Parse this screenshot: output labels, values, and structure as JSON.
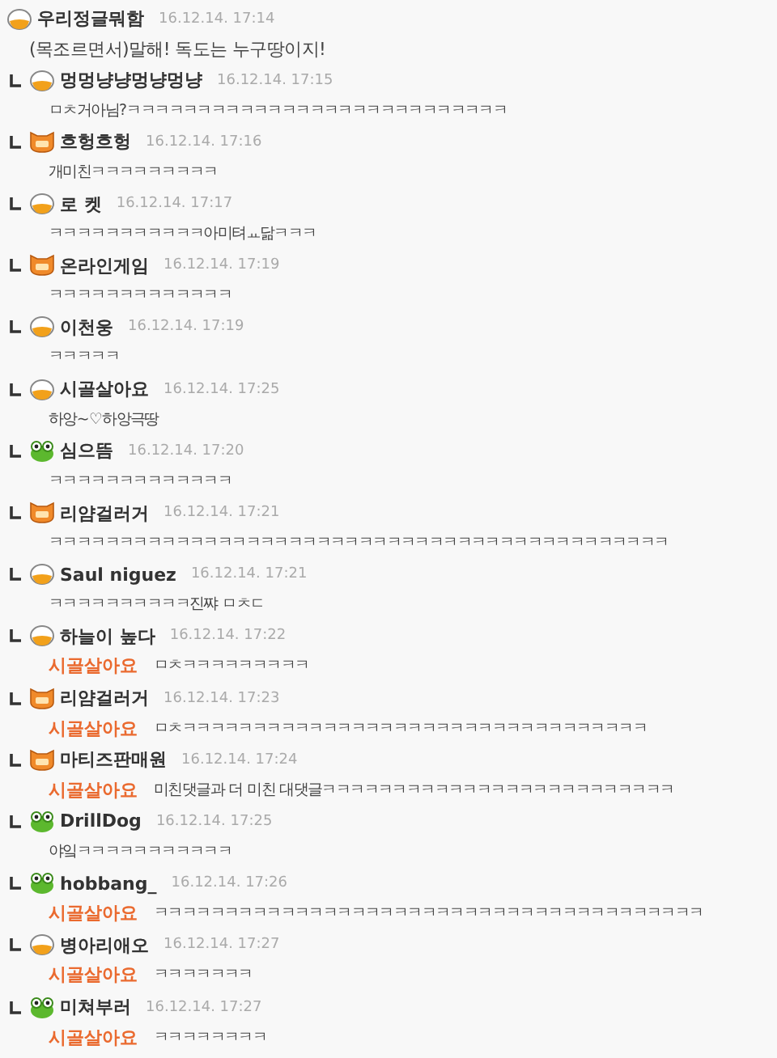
{
  "comments": [
    {
      "reply": false,
      "kind": "pot",
      "name": "우리정글뭐함",
      "time": "16.12.14. 17:14",
      "text": "(목조르면서)말해! 독도는 누구땅이지!"
    },
    {
      "reply": true,
      "kind": "pot",
      "name": "멍멍냥냥멍냥멍냥",
      "time": "16.12.14. 17:15",
      "text": "ㅁㅊ거아님?ㅋㅋㅋㅋㅋㅋㅋㅋㅋㅋㅋㅋㅋㅋㅋㅋㅋㅋㅋㅋㅋㅋㅋㅋㅋㅋㅋ"
    },
    {
      "reply": true,
      "kind": "cat",
      "name": "흐헝흐헝",
      "time": "16.12.14. 17:16",
      "text": "개미친ㅋㅋㅋㅋㅋㅋㅋㅋㅋ"
    },
    {
      "reply": true,
      "kind": "pot",
      "name": "로 켓",
      "time": "16.12.14. 17:17",
      "text": "ㅋㅋㅋㅋㅋㅋㅋㅋㅋㅋㅋ아미텨ㅛ닮ㅋㅋㅋ"
    },
    {
      "reply": true,
      "kind": "cat",
      "name": "온라인게임",
      "time": "16.12.14. 17:19",
      "text": "ㅋㅋㅋㅋㅋㅋㅋㅋㅋㅋㅋㅋㅋ"
    },
    {
      "reply": true,
      "kind": "pot",
      "name": "이천웅",
      "time": "16.12.14. 17:19",
      "text": "ㅋㅋㅋㅋㅋ"
    },
    {
      "reply": true,
      "kind": "pot",
      "name": "시골살아요",
      "time": "16.12.14. 17:25",
      "text": "하앙~♡하앙극땅"
    },
    {
      "reply": true,
      "kind": "frog",
      "name": "심으뜸",
      "time": "16.12.14. 17:20",
      "text": "ㅋㅋㅋㅋㅋㅋㅋㅋㅋㅋㅋㅋㅋ"
    },
    {
      "reply": true,
      "kind": "cat",
      "name": "리얌걸러거",
      "time": "16.12.14. 17:21",
      "text": "ㅋㅋㅋㅋㅋㅋㅋㅋㅋㅋㅋㅋㅋㅋㅋㅋㅋㅋㅋㅋㅋㅋㅋㅋㅋㅋㅋㅋㅋㅋㅋㅋㅋㅋㅋㅋㅋㅋㅋㅋㅋㅋㅋㅋ"
    },
    {
      "reply": true,
      "kind": "pot",
      "name": "Saul niguez",
      "time": "16.12.14. 17:21",
      "text": "ㅋㅋㅋㅋㅋㅋㅋㅋㅋㅋ진쨔 ㅁㅊㄷ"
    },
    {
      "reply": true,
      "kind": "pot",
      "name": "하늘이 높다",
      "time": "16.12.14. 17:22",
      "mention": "시골살아요",
      "text": "ㅁㅊㅋㅋㅋㅋㅋㅋㅋㅋㅋ"
    },
    {
      "reply": true,
      "kind": "cat",
      "name": "리얌걸러거",
      "time": "16.12.14. 17:23",
      "mention": "시골살아요",
      "text": "ㅁㅊㅋㅋㅋㅋㅋㅋㅋㅋㅋㅋㅋㅋㅋㅋㅋㅋㅋㅋㅋㅋㅋㅋㅋㅋㅋㅋㅋㅋㅋㅋㅋㅋㅋ"
    },
    {
      "reply": true,
      "kind": "cat",
      "name": "마티즈판매원",
      "time": "16.12.14. 17:24",
      "mention": "시골살아요",
      "text": "미친댓글과 더 미친 대댓글ㅋㅋㅋㅋㅋㅋㅋㅋㅋㅋㅋㅋㅋㅋㅋㅋㅋㅋㅋㅋㅋㅋㅋㅋㅋ"
    },
    {
      "reply": true,
      "kind": "frog",
      "name": "DrillDog",
      "time": "16.12.14. 17:25",
      "text": "야잌ㅋㅋㅋㅋㅋㅋㅋㅋㅋㅋㅋ"
    },
    {
      "reply": true,
      "kind": "frog",
      "name": "hobbang_",
      "time": "16.12.14. 17:26",
      "mention": "시골살아요",
      "text": "ㅋㅋㅋㅋㅋㅋㅋㅋㅋㅋㅋㅋㅋㅋㅋㅋㅋㅋㅋㅋㅋㅋㅋㅋㅋㅋㅋㅋㅋㅋㅋㅋㅋㅋㅋㅋㅋㅋㅋ"
    },
    {
      "reply": true,
      "kind": "pot",
      "name": "병아리애오",
      "time": "16.12.14. 17:27",
      "mention": "시골살아요",
      "text": "ㅋㅋㅋㅋㅋㅋㅋ"
    },
    {
      "reply": true,
      "kind": "frog",
      "name": "미쳐부러",
      "time": "16.12.14. 17:27",
      "mention": "시골살아요",
      "text": "ㅋㅋㅋㅋㅋㅋㅋㅋ"
    }
  ]
}
